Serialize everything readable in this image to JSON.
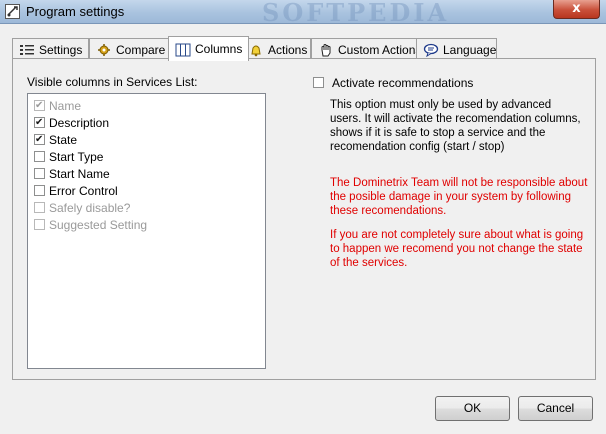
{
  "window": {
    "title": "Program settings",
    "watermark": "SOFTPEDIA",
    "close_glyph": "x"
  },
  "tabs": [
    {
      "label": "Settings",
      "icon": "list-icon"
    },
    {
      "label": "Compare",
      "icon": "gear-icon"
    },
    {
      "label": "Columns",
      "icon": "columns-icon",
      "active": true
    },
    {
      "label": "Actions",
      "icon": "bell-icon"
    },
    {
      "label": "Custom Actions",
      "icon": "hand-icon"
    },
    {
      "label": "Language",
      "icon": "speech-bubble-icon"
    }
  ],
  "columns_panel": {
    "list_label": "Visible columns in Services List:",
    "items": [
      {
        "label": "Name",
        "checked": true,
        "disabled": true
      },
      {
        "label": "Description",
        "checked": true,
        "disabled": false
      },
      {
        "label": "State",
        "checked": true,
        "disabled": false
      },
      {
        "label": "Start Type",
        "checked": false,
        "disabled": false
      },
      {
        "label": "Start Name",
        "checked": false,
        "disabled": false
      },
      {
        "label": "Error Control",
        "checked": false,
        "disabled": false
      },
      {
        "label": "Safely disable?",
        "checked": false,
        "disabled": true
      },
      {
        "label": "Suggested Setting",
        "checked": false,
        "disabled": true
      }
    ]
  },
  "recommendations": {
    "checkbox_label": "Activate recommendations",
    "checked": false,
    "info_text": "This option must only be used by advanced users. It will activate the recomendation columns, shows if it is safe to stop a service and the recomendation config (start / stop)",
    "warning_1": "The Dominetrix Team will not be responsible about the posible damage in your system by following these recomendations.",
    "warning_2": "If you are not completely sure about what is going to happen we recomend you not change the state of the services."
  },
  "buttons": {
    "ok": "OK",
    "cancel": "Cancel"
  },
  "colors": {
    "warning": "#e00000",
    "tab_active_bg": "#ffffff",
    "dialog_bg": "#f0f0f0"
  }
}
